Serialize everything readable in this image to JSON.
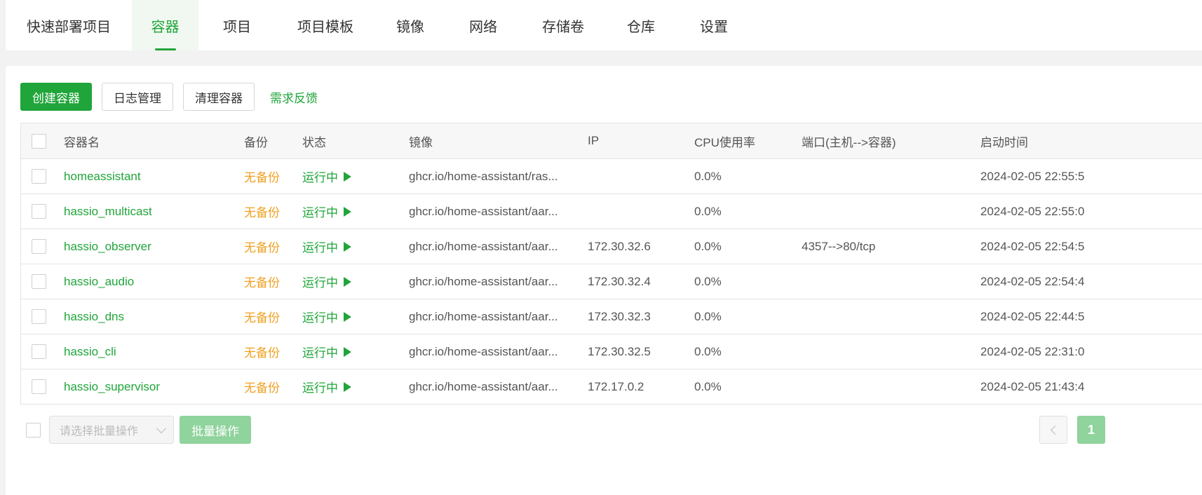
{
  "tabs": [
    {
      "label": "快速部署项目",
      "active": false
    },
    {
      "label": "容器",
      "active": true
    },
    {
      "label": "项目",
      "active": false
    },
    {
      "label": "项目模板",
      "active": false
    },
    {
      "label": "镜像",
      "active": false
    },
    {
      "label": "网络",
      "active": false
    },
    {
      "label": "存储卷",
      "active": false
    },
    {
      "label": "仓库",
      "active": false
    },
    {
      "label": "设置",
      "active": false
    }
  ],
  "toolbar": {
    "create_label": "创建容器",
    "logs_label": "日志管理",
    "clean_label": "清理容器",
    "feedback_label": "需求反馈"
  },
  "table": {
    "headers": {
      "name": "容器名",
      "backup": "备份",
      "status": "状态",
      "image": "镜像",
      "ip": "IP",
      "cpu": "CPU使用率",
      "port": "端口(主机-->容器)",
      "start": "启动时间"
    },
    "rows": [
      {
        "name": "homeassistant",
        "backup": "无备份",
        "status": "运行中",
        "image": "ghcr.io/home-assistant/ras...",
        "ip": "",
        "cpu": "0.0%",
        "port": "",
        "start": "2024-02-05 22:55:5"
      },
      {
        "name": "hassio_multicast",
        "backup": "无备份",
        "status": "运行中",
        "image": "ghcr.io/home-assistant/aar...",
        "ip": "",
        "cpu": "0.0%",
        "port": "",
        "start": "2024-02-05 22:55:0"
      },
      {
        "name": "hassio_observer",
        "backup": "无备份",
        "status": "运行中",
        "image": "ghcr.io/home-assistant/aar...",
        "ip": "172.30.32.6",
        "cpu": "0.0%",
        "port": "4357-->80/tcp",
        "start": "2024-02-05 22:54:5"
      },
      {
        "name": "hassio_audio",
        "backup": "无备份",
        "status": "运行中",
        "image": "ghcr.io/home-assistant/aar...",
        "ip": "172.30.32.4",
        "cpu": "0.0%",
        "port": "",
        "start": "2024-02-05 22:54:4"
      },
      {
        "name": "hassio_dns",
        "backup": "无备份",
        "status": "运行中",
        "image": "ghcr.io/home-assistant/aar...",
        "ip": "172.30.32.3",
        "cpu": "0.0%",
        "port": "",
        "start": "2024-02-05 22:44:5"
      },
      {
        "name": "hassio_cli",
        "backup": "无备份",
        "status": "运行中",
        "image": "ghcr.io/home-assistant/aar...",
        "ip": "172.30.32.5",
        "cpu": "0.0%",
        "port": "",
        "start": "2024-02-05 22:31:0"
      },
      {
        "name": "hassio_supervisor",
        "backup": "无备份",
        "status": "运行中",
        "image": "ghcr.io/home-assistant/aar...",
        "ip": "172.17.0.2",
        "cpu": "0.0%",
        "port": "",
        "start": "2024-02-05 21:43:4"
      }
    ]
  },
  "footer": {
    "batch_placeholder": "请选择批量操作",
    "batch_button": "批量操作",
    "current_page": "1"
  },
  "colors": {
    "accent": "#20a53a",
    "warning": "#f0a020"
  }
}
